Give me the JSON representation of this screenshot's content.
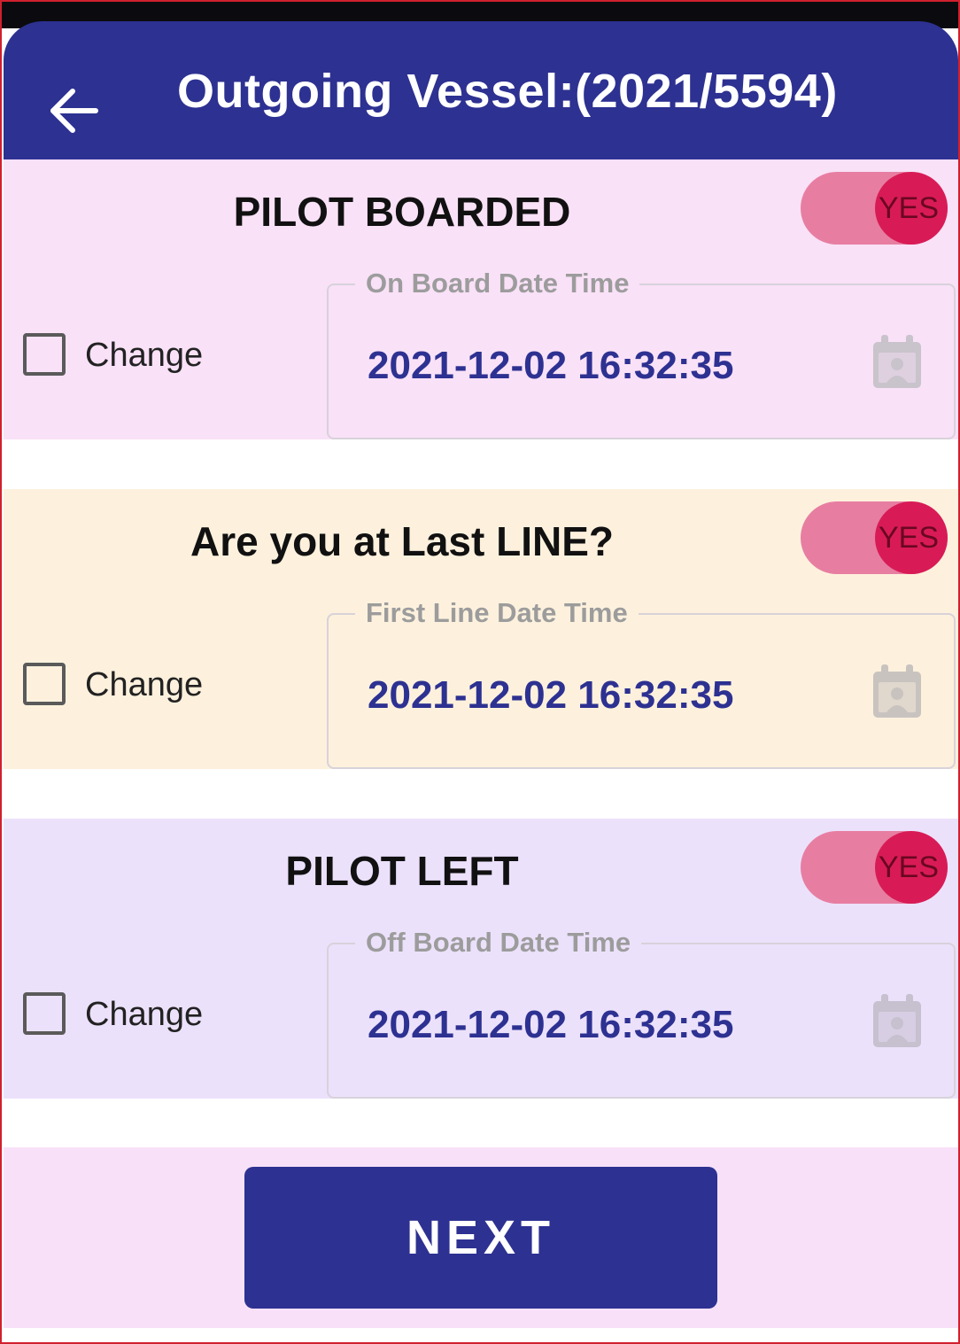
{
  "header": {
    "title": "Outgoing Vessel:(2021/5594)",
    "back_icon": "back-arrow-icon"
  },
  "colors": {
    "appbar": "#2d3191",
    "section1_bg": "#f9e1f7",
    "section2_bg": "#fdf1dd",
    "section3_bg": "#ece1fb",
    "toggle_on": "#d81b56",
    "value_text": "#2d3191"
  },
  "sections": [
    {
      "title": "PILOT BOARDED",
      "toggle_label": "YES",
      "toggle_on": true,
      "change_label": "Change",
      "change_checked": false,
      "field_label": "On Board Date Time",
      "field_value": "2021-12-02 16:32:35",
      "field_icon": "calendar-icon"
    },
    {
      "title": "Are you at Last LINE?",
      "toggle_label": "YES",
      "toggle_on": true,
      "change_label": "Change",
      "change_checked": false,
      "field_label": "First Line Date Time",
      "field_value": "2021-12-02 16:32:35",
      "field_icon": "calendar-icon"
    },
    {
      "title": "PILOT LEFT",
      "toggle_label": "YES",
      "toggle_on": true,
      "change_label": "Change",
      "change_checked": false,
      "field_label": "Off Board Date Time",
      "field_value": "2021-12-02 16:32:35",
      "field_icon": "calendar-icon"
    }
  ],
  "footer": {
    "next_label": "NEXT"
  }
}
